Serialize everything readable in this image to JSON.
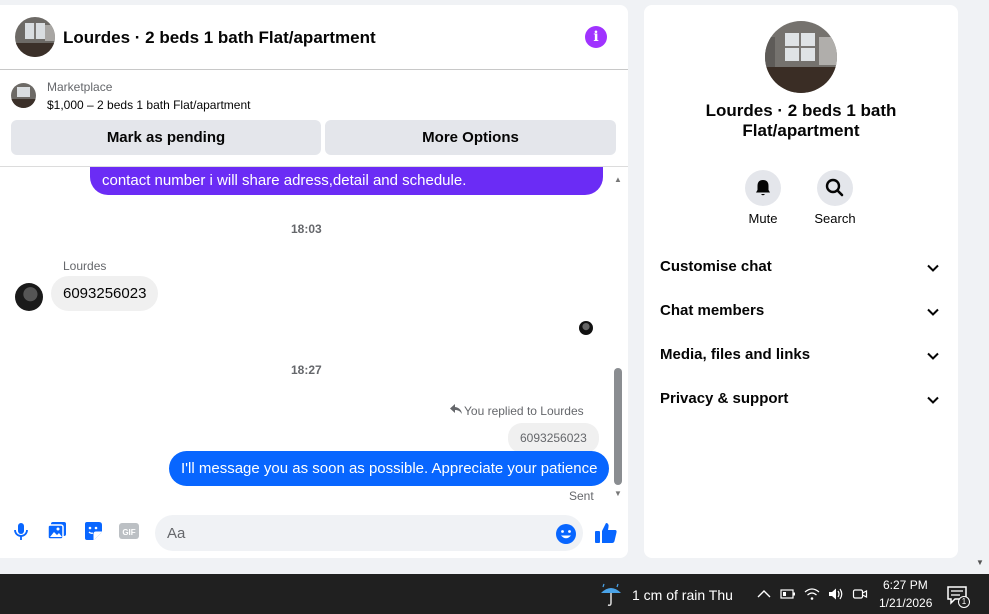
{
  "header": {
    "title": "Lourdes · 2 beds 1 bath Flat/apartment",
    "info_icon": "i"
  },
  "listing": {
    "source": "Marketplace",
    "price_line": "$1,000 – 2 beds 1 bath Flat/apartment",
    "pending_button": "Mark as pending",
    "more_button": "More Options"
  },
  "messages": {
    "partial_outgoing": "contact number i will share adress,detail and schedule.",
    "time_1": "18:03",
    "sender_name": "Lourdes",
    "incoming_text": "6093256023",
    "time_2": "18:27",
    "reply_note": "You replied to Lourdes",
    "quoted_text": "6093256023",
    "outgoing_text": "I'll message you as soon as possible. Appreciate your patience",
    "status": "Sent"
  },
  "composer": {
    "placeholder": "Aa"
  },
  "info_panel": {
    "title": "Lourdes · 2 beds 1 bath Flat/apartment",
    "mute_label": "Mute",
    "search_label": "Search",
    "sections": [
      {
        "label": "Customise chat"
      },
      {
        "label": "Chat members"
      },
      {
        "label": "Media, files and links"
      },
      {
        "label": "Privacy & support"
      }
    ]
  },
  "taskbar": {
    "weather": "1 cm of rain Thu",
    "time": "6:27 PM",
    "date": "1/21/2026",
    "notification_count": "1"
  },
  "colors": {
    "accent_blue": "#0866ff",
    "accent_purple": "#a033ff",
    "outgoing_purple": "#6b2cf5",
    "taskbar": "#202020"
  },
  "icons": [
    "info-icon",
    "mic-icon",
    "photo-icon",
    "sticker-icon",
    "gif-icon",
    "emoji-icon",
    "like-icon",
    "bell-icon",
    "search-icon",
    "chevron-down-icon",
    "reply-icon",
    "weather-rain-icon",
    "notification-icon"
  ]
}
